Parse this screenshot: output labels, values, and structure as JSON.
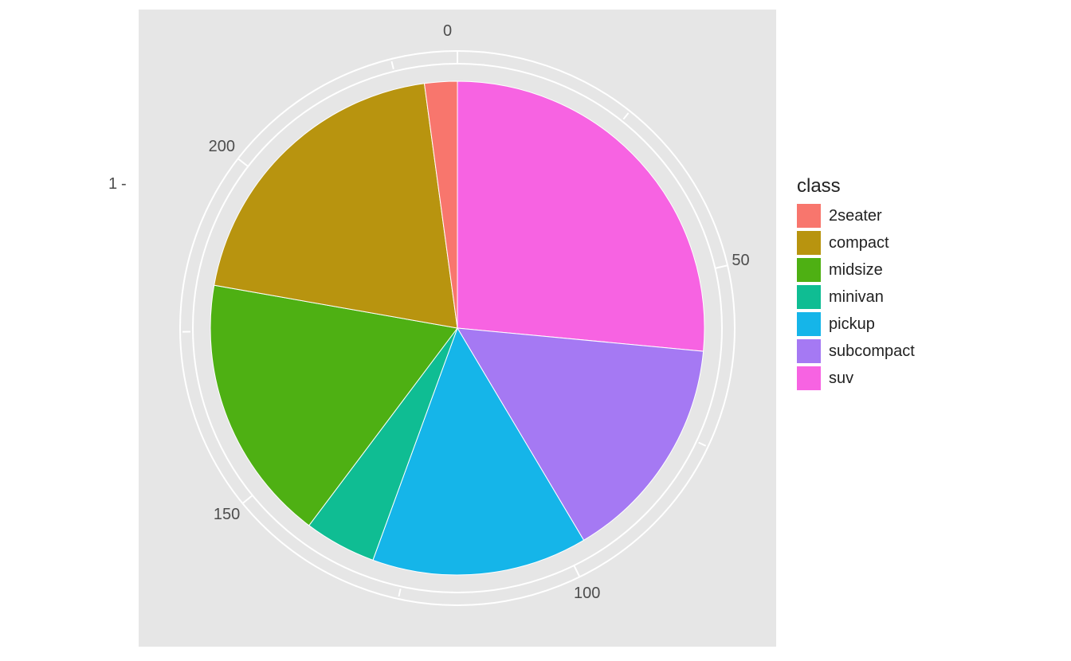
{
  "chart_data": {
    "type": "pie",
    "title": "",
    "xlabel": "",
    "ylabel": "",
    "total": 234,
    "angular_ticks": [
      0,
      50,
      100,
      150,
      200
    ],
    "radial_ticks": [
      1
    ],
    "legend_title": "class",
    "series": [
      {
        "name": "suv",
        "value": 62,
        "color": "#f763e2"
      },
      {
        "name": "subcompact",
        "value": 35,
        "color": "#a579f3"
      },
      {
        "name": "pickup",
        "value": 33,
        "color": "#15b5e9"
      },
      {
        "name": "minivan",
        "value": 11,
        "color": "#0fbd93"
      },
      {
        "name": "midsize",
        "value": 41,
        "color": "#4eb013"
      },
      {
        "name": "compact",
        "value": 47,
        "color": "#b8940f"
      },
      {
        "name": "2seater",
        "value": 5,
        "color": "#f8766d"
      }
    ],
    "legend_order": [
      "2seater",
      "compact",
      "midsize",
      "minivan",
      "pickup",
      "subcompact",
      "suv"
    ]
  }
}
